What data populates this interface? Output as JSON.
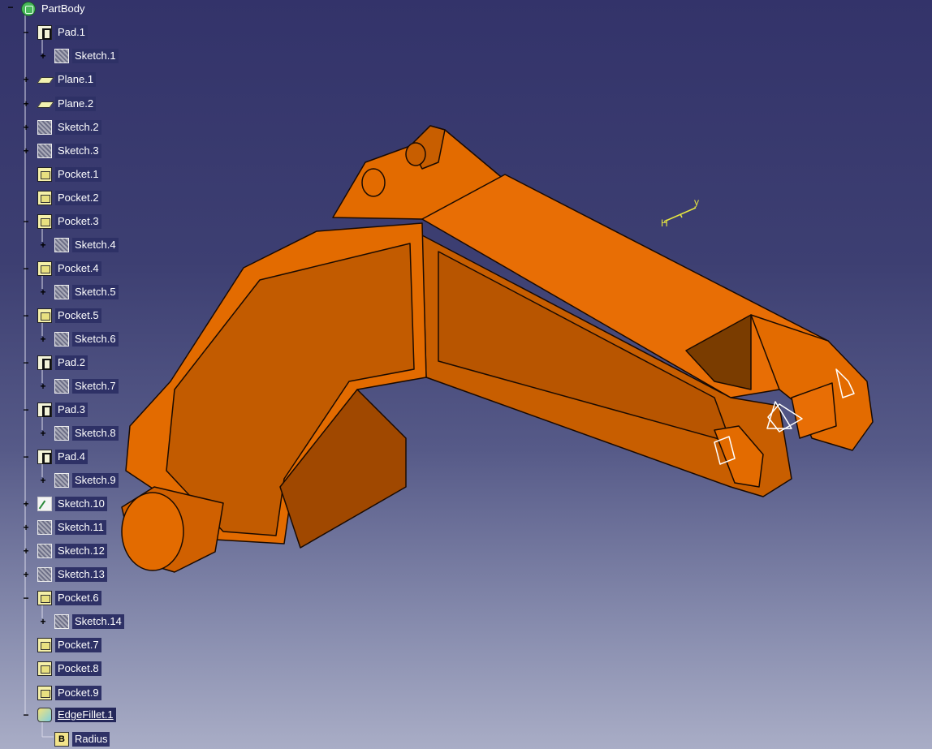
{
  "tree": {
    "root": {
      "label": "PartBody",
      "icon": "partbody-icon"
    },
    "items": [
      {
        "label": "Pad.1",
        "icon": "pad-icon",
        "expander": "−"
      },
      {
        "label": "Sketch.1",
        "icon": "sketch-icon",
        "expander": "+"
      },
      {
        "label": "Plane.1",
        "icon": "plane-icon",
        "expander": "+"
      },
      {
        "label": "Plane.2",
        "icon": "plane-icon",
        "expander": "+"
      },
      {
        "label": "Sketch.2",
        "icon": "sketch-icon",
        "expander": "+"
      },
      {
        "label": "Sketch.3",
        "icon": "sketch-icon",
        "expander": "+"
      },
      {
        "label": "Pocket.1",
        "icon": "pocket-icon",
        "expander": ""
      },
      {
        "label": "Pocket.2",
        "icon": "pocket-icon",
        "expander": ""
      },
      {
        "label": "Pocket.3",
        "icon": "pocket-icon",
        "expander": "−"
      },
      {
        "label": "Sketch.4",
        "icon": "sketch-icon",
        "expander": "+"
      },
      {
        "label": "Pocket.4",
        "icon": "pocket-icon",
        "expander": "−"
      },
      {
        "label": "Sketch.5",
        "icon": "sketch-icon",
        "expander": "+"
      },
      {
        "label": "Pocket.5",
        "icon": "pocket-icon",
        "expander": "−"
      },
      {
        "label": "Sketch.6",
        "icon": "sketch-icon",
        "expander": "+"
      },
      {
        "label": "Pad.2",
        "icon": "pad-icon",
        "expander": "−"
      },
      {
        "label": "Sketch.7",
        "icon": "sketch-icon",
        "expander": "+"
      },
      {
        "label": "Pad.3",
        "icon": "pad-icon",
        "expander": "−"
      },
      {
        "label": "Sketch.8",
        "icon": "sketch-icon",
        "expander": "+"
      },
      {
        "label": "Pad.4",
        "icon": "pad-icon",
        "expander": "−"
      },
      {
        "label": "Sketch.9",
        "icon": "sketch-icon",
        "expander": "+"
      },
      {
        "label": "Sketch.10",
        "icon": "sketch-white-icon",
        "expander": "+"
      },
      {
        "label": "Sketch.11",
        "icon": "sketch-icon",
        "expander": "+"
      },
      {
        "label": "Sketch.12",
        "icon": "sketch-icon",
        "expander": "+"
      },
      {
        "label": "Sketch.13",
        "icon": "sketch-icon",
        "expander": "+"
      },
      {
        "label": "Pocket.6",
        "icon": "pocket-icon",
        "expander": "−"
      },
      {
        "label": "Sketch.14",
        "icon": "sketch-icon",
        "expander": "+"
      },
      {
        "label": "Pocket.7",
        "icon": "pocket-icon",
        "expander": ""
      },
      {
        "label": "Pocket.8",
        "icon": "pocket-icon",
        "expander": ""
      },
      {
        "label": "Pocket.9",
        "icon": "pocket-icon",
        "expander": ""
      },
      {
        "label": "EdgeFillet.1",
        "icon": "edgefillet-icon",
        "expander": "−",
        "selected": true
      },
      {
        "label": "Radius",
        "icon": "radius-icon",
        "expander": ""
      }
    ]
  },
  "compass": {
    "axis_y": "y",
    "axis_h": "H"
  },
  "colors": {
    "part": "#e36b00",
    "part_dark": "#b04e00",
    "part_light": "#f08a2a",
    "background_top": "#33336a",
    "background_bottom": "#a9adc6"
  }
}
